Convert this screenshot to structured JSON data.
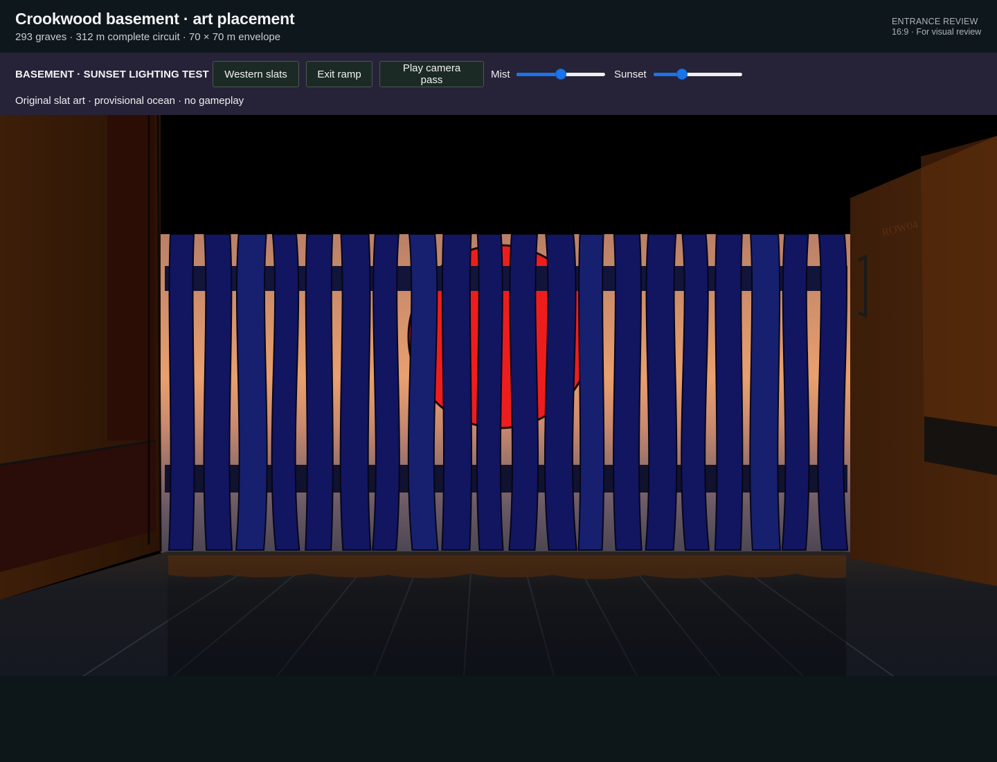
{
  "header": {
    "title": "Crookwood basement · art placement",
    "subtitle": "293 graves · 312 m complete circuit · 70 × 70 m envelope",
    "review_label": "ENTRANCE REVIEW",
    "review_detail": "16:9 · For visual review"
  },
  "toolbar": {
    "scene_label": "BASEMENT · SUNSET LIGHTING TEST",
    "buttons": {
      "western_slats": "Western slats",
      "exit_ramp": "Exit ramp",
      "play_camera_pass": "Play camera pass"
    },
    "mist": {
      "label": "Mist",
      "value": 0.5
    },
    "sunset": {
      "label": "Sunset",
      "value": 0.32
    },
    "note": "Original slat art · provisional ocean · no gameplay"
  },
  "scene": {
    "wall_sign": "ROW04",
    "colors": {
      "slat": "#121560",
      "sun": "#ee1d1d",
      "sky_top": "#c78a6c",
      "sky_bottom": "#f0a870",
      "floor": "#16191f",
      "wall_left": "#3a1d08",
      "wall_right": "#3a1e0a"
    }
  }
}
